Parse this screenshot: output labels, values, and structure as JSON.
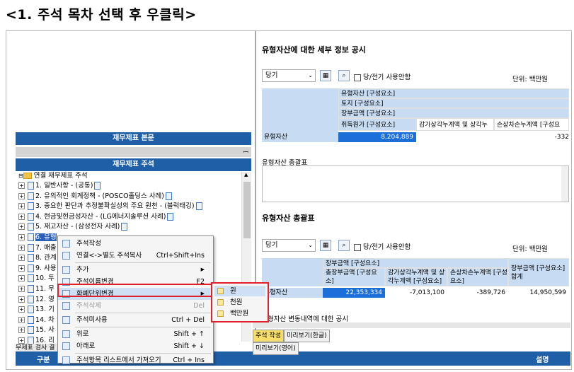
{
  "heading": "<1. 주석 목차 선택 후 우클릭>",
  "left": {
    "header1": "재무제표 본문",
    "header2": "재무제표 주석",
    "pin": "ꟷ",
    "root": "연결 재무제표 주석",
    "items": [
      {
        "label": "1. 일반사항 - (공통)",
        "sel": false
      },
      {
        "label": "2. 유의적인 회계정책 - (POSCO홀딩스 사례)",
        "sel": false
      },
      {
        "label": "3. 중요한 판단과 추정불확실성의 주요 원천 - (블럭태깅)",
        "sel": false
      },
      {
        "label": "4. 현금및현금성자산 - (LG에너지솔루션 사례)",
        "sel": false
      },
      {
        "label": "5. 재고자산 - (삼성전자 사례)",
        "sel": false
      },
      {
        "label": "6. 유형",
        "sel": true
      },
      {
        "label": "7. 매출",
        "sel": false
      },
      {
        "label": "8. 관계",
        "sel": false
      },
      {
        "label": "9. 사용",
        "sel": false
      },
      {
        "label": "10. 투",
        "sel": false
      },
      {
        "label": "11. 무",
        "sel": false
      },
      {
        "label": "12. 영",
        "sel": false
      },
      {
        "label": "13. 기",
        "sel": false
      },
      {
        "label": "14. 차",
        "sel": false
      },
      {
        "label": "15. 사",
        "sel": false
      },
      {
        "label": "16. 리",
        "sel": false
      }
    ],
    "footer_tab": "무제표 검사 결",
    "footer_col1": "구분"
  },
  "context_menu": {
    "items": [
      {
        "label": "주석작성",
        "shortcut": "",
        "sub": false,
        "disabled": false
      },
      {
        "label": "연결<->별도 주석복사",
        "shortcut": "Ctrl+Shift+Ins",
        "sub": false,
        "disabled": false
      },
      {
        "label": "추가",
        "shortcut": "",
        "sub": true,
        "disabled": false
      },
      {
        "label": "주석이름변경",
        "shortcut": "F2",
        "sub": false,
        "disabled": false
      },
      {
        "label": "화폐단위변경",
        "shortcut": "",
        "sub": true,
        "disabled": false
      },
      {
        "label": "주석삭제",
        "shortcut": "Del",
        "sub": false,
        "disabled": true
      },
      {
        "label": "주석미사용",
        "shortcut": "Ctrl + Del",
        "sub": false,
        "disabled": false
      },
      {
        "label": "위로",
        "shortcut": "Shift + ↑",
        "sub": false,
        "disabled": false
      },
      {
        "label": "아래로",
        "shortcut": "Shift + ↓",
        "sub": false,
        "disabled": false
      },
      {
        "label": "주석항목 리스트에서 가져오기",
        "shortcut": "Ctrl + Ins",
        "sub": false,
        "disabled": false
      }
    ],
    "arrow": "▶"
  },
  "submenu": {
    "items": [
      "원",
      "천원",
      "백만원"
    ]
  },
  "right": {
    "title": "유형자산에 대한 세부 정보 공시",
    "select1": "당기",
    "checkbox_label": "당/전기 사용안함",
    "unit_label": "단위: 백만원",
    "t1_headers": [
      "유형자산 [구성요소]",
      "토지 [구성요소]",
      "장부금액 [구성요소]",
      "취득원가 [구성요소]",
      "감가상각누계액 및 상각누",
      "손상차손누계액 [구성요"
    ],
    "t1_row_label": "유형자산",
    "t1_value1": "8,204,889",
    "t1_value2": "-332",
    "section_label": "유형자산 총괄표",
    "title2": "유형자산 총괄표",
    "select2": "당기",
    "checkbox_label2": "당/전기 사용안함",
    "unit_label2": "단위: 백만원",
    "t2_headers": [
      "장부금액 [구성요소]",
      "총장부금액 [구성요소]",
      "감가상각누계액 및 상각누계액 [구성요소]",
      "손상차손누계액 [구성요소]",
      "장부금액 [구성요소] 합계"
    ],
    "t2_row_label": "유형자산",
    "t2_values": [
      "22,353,334",
      "-7,013,100",
      "-389,726",
      "14,950,599"
    ],
    "section3": "형자산 변동내역에 대한 공시",
    "tabs": [
      "주석 작성",
      "미리보기(한글)",
      "미리보기(영어)"
    ],
    "footer_col": "설명"
  },
  "colors": {
    "accent": "#1f5fa8",
    "highlight": "#e0202a",
    "value_cell": "#1c6fd8"
  }
}
